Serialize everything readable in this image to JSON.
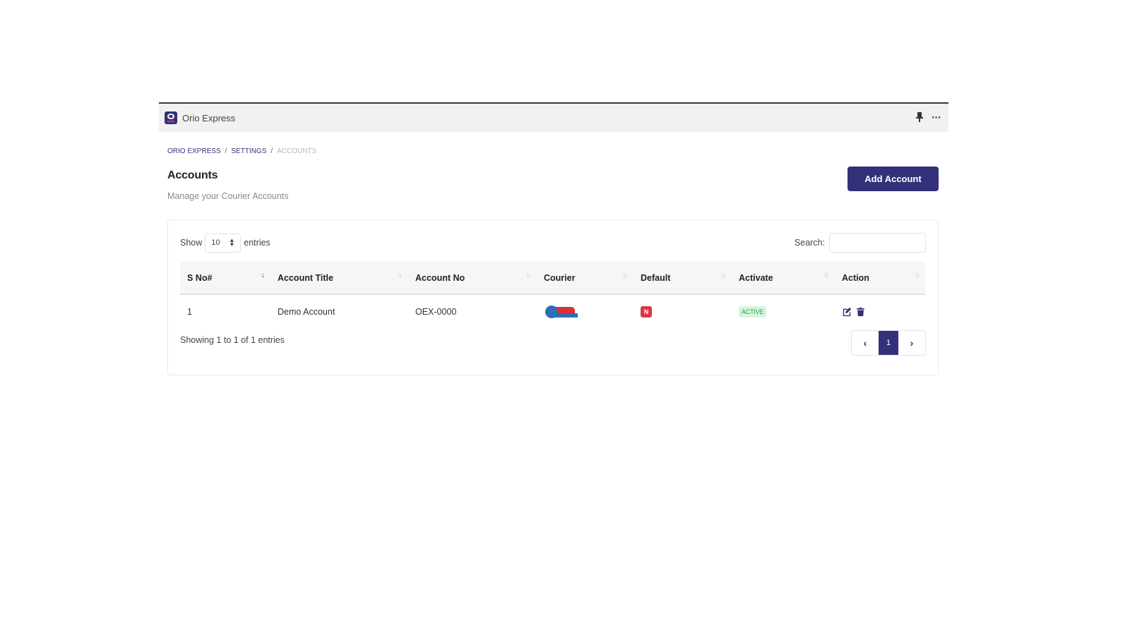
{
  "window": {
    "title": "Orio Express",
    "icons": [
      "pin-icon",
      "more-icon"
    ],
    "more_label": "⋯"
  },
  "breadcrumb": [
    {
      "label": "ORIO EXPRESS"
    },
    {
      "label": "SETTINGS"
    },
    {
      "label": "ACCOUNTS"
    }
  ],
  "breadcrumb_separator": "/",
  "header": {
    "title": "Accounts",
    "subtitle": "Manage your Courier Accounts",
    "add_button_label": "Add Account"
  },
  "table_controls": {
    "show_label": "Show",
    "entries_value": "10",
    "entries_label": "entries",
    "search_label": "Search:",
    "search_value": ""
  },
  "table": {
    "columns": [
      "S No#",
      "Account Title",
      "Account No",
      "Courier",
      "Default",
      "Activate",
      "Action"
    ],
    "rows": [
      {
        "s_no": "1",
        "account_title": "Demo Account",
        "account_no": "OEX-0000",
        "courier_icon": "courier-logo-dot-express",
        "default": "N",
        "activate": "ACTIVE",
        "actions": [
          "edit-icon",
          "trash-icon"
        ]
      }
    ]
  },
  "footer": {
    "info": "Showing 1 to 1 of 1 entries",
    "pagination": {
      "prev_label": "‹",
      "current_page": "1",
      "next_label": "›"
    }
  },
  "colors": {
    "primary": "#34317a",
    "default_badge": "#dc3545",
    "active_badge_bg": "#d6f5de",
    "active_badge_text": "#2ca24e"
  }
}
